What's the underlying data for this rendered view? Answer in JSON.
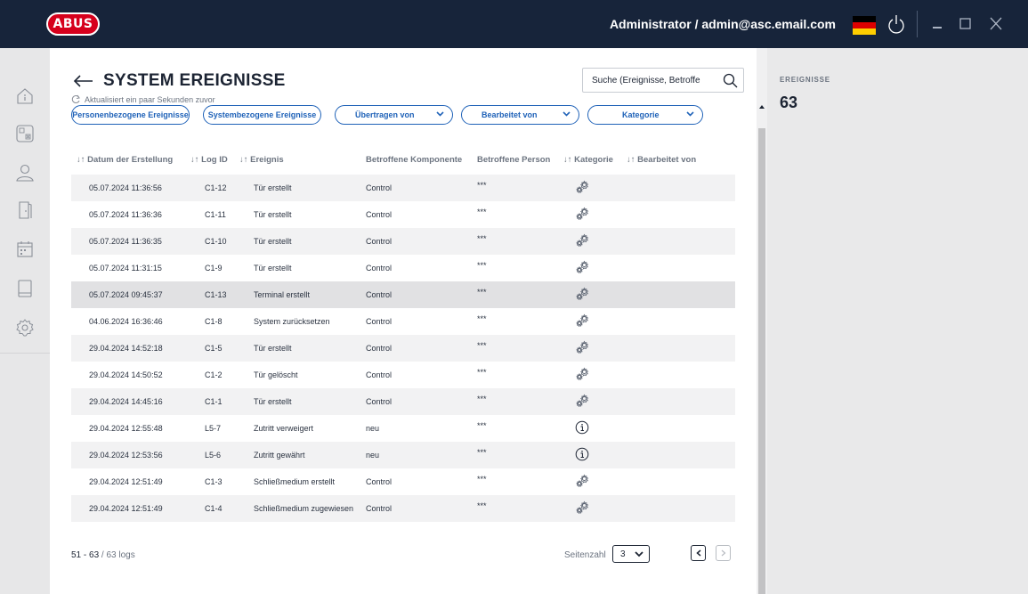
{
  "header": {
    "logo_text": "ABUS",
    "user_label": "Administrator / admin@asc.email.com",
    "flag_colors": [
      "#000000",
      "#dd0000",
      "#ffce00"
    ],
    "icons": [
      "power-icon",
      "minimize-icon",
      "maximize-icon",
      "close-icon"
    ]
  },
  "sidebar": {
    "items": [
      {
        "name": "home-icon"
      },
      {
        "name": "controller-icon"
      },
      {
        "name": "user-icon"
      },
      {
        "name": "door-icon"
      },
      {
        "name": "calendar-icon"
      },
      {
        "name": "device-icon"
      },
      {
        "name": "settings-icon"
      }
    ]
  },
  "page": {
    "title": "SYSTEM EREIGNISSE",
    "refresh_text": "Aktualisiert ein paar Sekunden zuvor",
    "search_placeholder": "Suche (Ereignisse, Betroffe"
  },
  "filters": {
    "personal": "Personenbezogene Ereignisse",
    "system": "Systembezogene Ereignisse",
    "transferred": "Übertragen von",
    "edited": "Bearbeitet von",
    "category": "Kategorie"
  },
  "table": {
    "headers": {
      "date": "↓↑ Datum der Erstellung",
      "logid": "↓↑ Log ID",
      "event": "↓↑ Ereignis",
      "component": "Betroffene Komponente",
      "person": "Betroffene Person",
      "category": "↓↑ Kategorie",
      "editor": "↓↑ Bearbeitet von"
    },
    "rows": [
      {
        "date": "05.07.2024 11:36:56",
        "logid": "C1-12",
        "event": "Tür erstellt",
        "component": "Control",
        "person": "***",
        "category_icon": "system-gear-icon",
        "editor": ""
      },
      {
        "date": "05.07.2024 11:36:36",
        "logid": "C1-11",
        "event": "Tür erstellt",
        "component": "Control",
        "person": "***",
        "category_icon": "system-gear-icon",
        "editor": ""
      },
      {
        "date": "05.07.2024 11:36:35",
        "logid": "C1-10",
        "event": "Tür erstellt",
        "component": "Control",
        "person": "***",
        "category_icon": "system-gear-icon",
        "editor": ""
      },
      {
        "date": "05.07.2024 11:31:15",
        "logid": "C1-9",
        "event": "Tür erstellt",
        "component": "Control",
        "person": "***",
        "category_icon": "system-gear-icon",
        "editor": ""
      },
      {
        "date": "05.07.2024 09:45:37",
        "logid": "C1-13",
        "event": "Terminal erstellt",
        "component": "Control",
        "person": "***",
        "category_icon": "system-gear-icon",
        "editor": ""
      },
      {
        "date": "04.06.2024 16:36:46",
        "logid": "C1-8",
        "event": "System zurücksetzen",
        "component": "Control",
        "person": "***",
        "category_icon": "system-gear-icon",
        "editor": ""
      },
      {
        "date": "29.04.2024 14:52:18",
        "logid": "C1-5",
        "event": "Tür erstellt",
        "component": "Control",
        "person": "***",
        "category_icon": "system-gear-icon",
        "editor": ""
      },
      {
        "date": "29.04.2024 14:50:52",
        "logid": "C1-2",
        "event": "Tür gelöscht",
        "component": "Control",
        "person": "***",
        "category_icon": "system-gear-icon",
        "editor": ""
      },
      {
        "date": "29.04.2024 14:45:16",
        "logid": "C1-1",
        "event": "Tür erstellt",
        "component": "Control",
        "person": "***",
        "category_icon": "system-gear-icon",
        "editor": ""
      },
      {
        "date": "29.04.2024 12:55:48",
        "logid": "L5-7",
        "event": "Zutritt verweigert",
        "component": "neu",
        "person": "***",
        "category_icon": "info-icon",
        "editor": ""
      },
      {
        "date": "29.04.2024 12:53:56",
        "logid": "L5-6",
        "event": "Zutritt gewährt",
        "component": "neu",
        "person": "***",
        "category_icon": "info-icon",
        "editor": ""
      },
      {
        "date": "29.04.2024 12:51:49",
        "logid": "C1-3",
        "event": "Schließmedium erstellt",
        "component": "Control",
        "person": "***",
        "category_icon": "system-gear-icon",
        "editor": ""
      },
      {
        "date": "29.04.2024 12:51:49",
        "logid": "C1-4",
        "event": "Schließmedium zugewiesen",
        "component": "Control",
        "person": "***",
        "category_icon": "system-gear-icon",
        "editor": ""
      }
    ]
  },
  "footer": {
    "range_bold": "51 - 63",
    "range_rest": " / 63 logs",
    "page_label": "Seitenzahl",
    "page_value": "3",
    "prev_label": "<",
    "next_label": ">"
  },
  "stats": {
    "label": "EREIGNISSE",
    "value": "63"
  },
  "colors": {
    "topbar": "#17243a",
    "accent": "#1f62b8",
    "logo_red": "#d6001c"
  }
}
